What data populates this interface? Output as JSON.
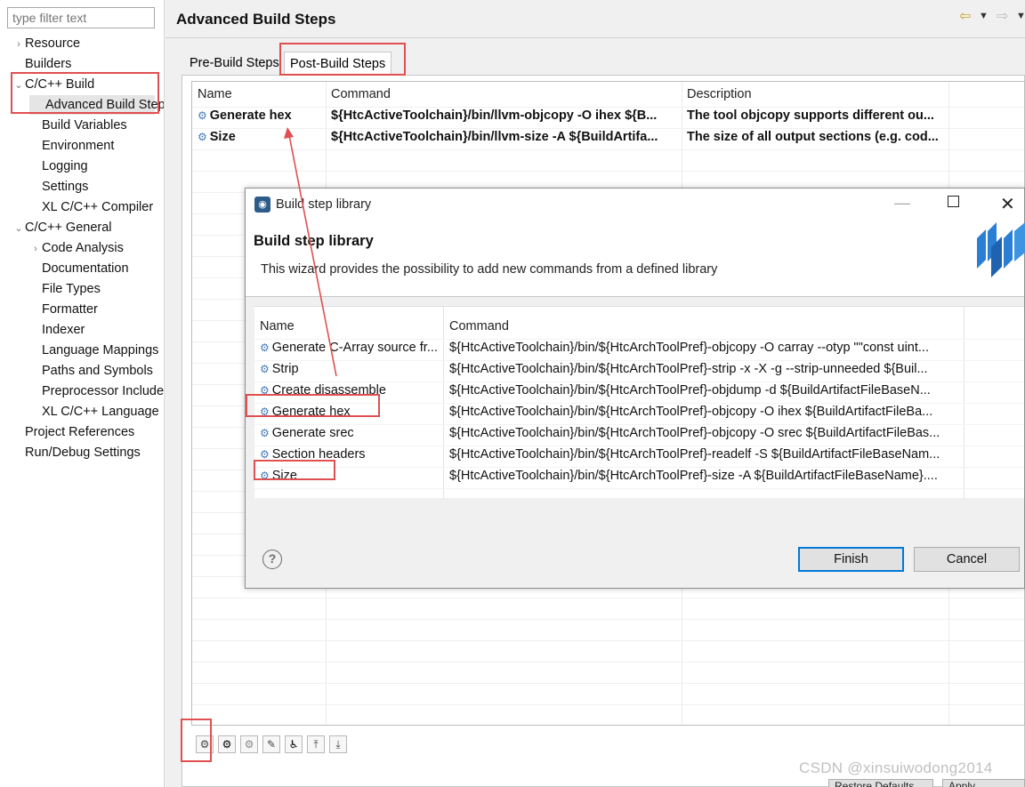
{
  "filter": {
    "placeholder": "type filter text"
  },
  "tree": [
    {
      "label": "Resource",
      "expander": "›"
    },
    {
      "label": "Builders",
      "expander": ""
    },
    {
      "label": "C/C++ Build",
      "expander": "⌄"
    },
    {
      "label": "Advanced Build Steps",
      "expander": ""
    },
    {
      "label": "Build Variables",
      "expander": ""
    },
    {
      "label": "Environment",
      "expander": ""
    },
    {
      "label": "Logging",
      "expander": ""
    },
    {
      "label": "Settings",
      "expander": ""
    },
    {
      "label": "XL C/C++ Compiler",
      "expander": ""
    },
    {
      "label": "C/C++ General",
      "expander": "⌄"
    },
    {
      "label": "Code Analysis",
      "expander": "›"
    },
    {
      "label": "Documentation",
      "expander": ""
    },
    {
      "label": "File Types",
      "expander": ""
    },
    {
      "label": "Formatter",
      "expander": ""
    },
    {
      "label": "Indexer",
      "expander": ""
    },
    {
      "label": "Language Mappings",
      "expander": ""
    },
    {
      "label": "Paths and Symbols",
      "expander": ""
    },
    {
      "label": "Preprocessor Include",
      "expander": ""
    },
    {
      "label": "XL C/C++ Language",
      "expander": ""
    },
    {
      "label": "Project References",
      "expander": ""
    },
    {
      "label": "Run/Debug Settings",
      "expander": ""
    }
  ],
  "header": {
    "title": "Advanced Build Steps",
    "back_icon": "back-arrow-icon",
    "forward_icon": "forward-arrow-icon"
  },
  "tabs": [
    {
      "label": "Pre-Build Steps"
    },
    {
      "label": "Post-Build Steps"
    }
  ],
  "main_table": {
    "headers": [
      "Name",
      "Command",
      "Description"
    ],
    "rows": [
      {
        "name": "Generate hex",
        "command": "${HtcActiveToolchain}/bin/llvm-objcopy -O ihex ${B...",
        "description": "The tool objcopy supports different ou..."
      },
      {
        "name": "Size",
        "command": "${HtcActiveToolchain}/bin/llvm-size -A ${BuildArtifa...",
        "description": "The size of all output sections (e.g. cod..."
      }
    ]
  },
  "dialog": {
    "title": "Build step library",
    "heading": "Build step library",
    "description": "This wizard provides the possibility to add new commands from a defined library",
    "headers": [
      "Name",
      "Command"
    ],
    "rows": [
      {
        "name": "Generate C-Array source fr...",
        "command": "${HtcActiveToolchain}/bin/${HtcArchToolPref}-objcopy -O carray --otyp \"\"const uint..."
      },
      {
        "name": "Strip",
        "command": "${HtcActiveToolchain}/bin/${HtcArchToolPref}-strip -x -X -g --strip-unneeded ${Buil..."
      },
      {
        "name": "Create disassemble",
        "command": "${HtcActiveToolchain}/bin/${HtcArchToolPref}-objdump -d ${BuildArtifactFileBaseN..."
      },
      {
        "name": "Generate hex",
        "command": "${HtcActiveToolchain}/bin/${HtcArchToolPref}-objcopy -O ihex ${BuildArtifactFileBa..."
      },
      {
        "name": "Generate srec",
        "command": "${HtcActiveToolchain}/bin/${HtcArchToolPref}-objcopy -O srec ${BuildArtifactFileBas..."
      },
      {
        "name": "Section headers",
        "command": "${HtcActiveToolchain}/bin/${HtcArchToolPref}-readelf -S ${BuildArtifactFileBaseNam..."
      },
      {
        "name": "Size",
        "command": "${HtcActiveToolchain}/bin/${HtcArchToolPref}-size -A ${BuildArtifactFileBaseName}...."
      }
    ],
    "help_glyph": "?",
    "finish_label": "Finish",
    "cancel_label": "Cancel"
  },
  "bottom": {
    "restore_label": "Restore Defaults",
    "apply_label": "Apply"
  },
  "watermark": "CSDN @xinsuiwodong2014",
  "colors": {
    "annotation_red": "#e05050",
    "accent_blue": "#0078d7",
    "gear_blue": "#4a7ab5"
  }
}
